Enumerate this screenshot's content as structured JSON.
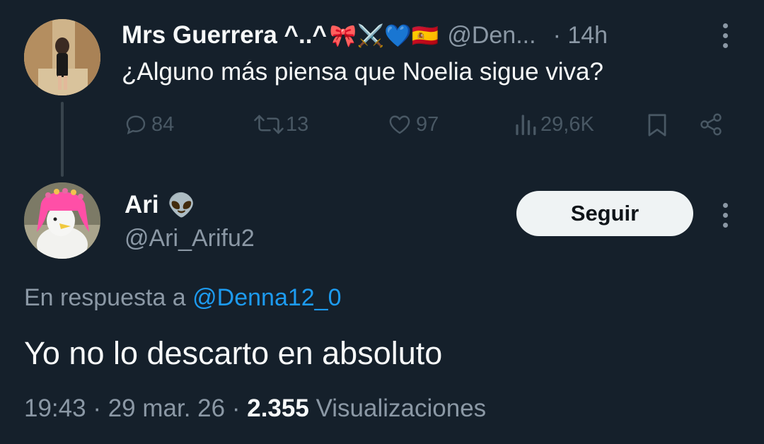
{
  "parent_tweet": {
    "display_name": "Mrs Guerrera ^..^",
    "name_emojis": [
      "🎀",
      "⚔️",
      "💙",
      "🇪🇸"
    ],
    "handle": "@Den...",
    "time": "· 14h",
    "text": "¿Alguno más piensa que Noelia sigue viva?",
    "replies": "84",
    "retweets": "13",
    "likes": "97",
    "views": "29,6K"
  },
  "reply_tweet": {
    "display_name": "Ari",
    "name_emoji": "👽",
    "handle": "@Ari_Arifu2",
    "follow_label": "Seguir",
    "in_reply_prefix": "En respuesta a",
    "in_reply_handle": "@Denna12_0",
    "text": "Yo no lo descarto en absoluto",
    "time": "19:43",
    "date": "29 mar. 26",
    "views_count": "2.355",
    "views_label": "Visualizaciones"
  },
  "colors": {
    "background": "#15202b",
    "text": "#f7f9f9",
    "muted": "#8b98a5",
    "link": "#1d9bf0",
    "button_bg": "#eff3f4"
  },
  "icons": [
    "reply-icon",
    "retweet-icon",
    "like-icon",
    "views-icon",
    "bookmark-icon",
    "share-icon",
    "more-icon"
  ]
}
